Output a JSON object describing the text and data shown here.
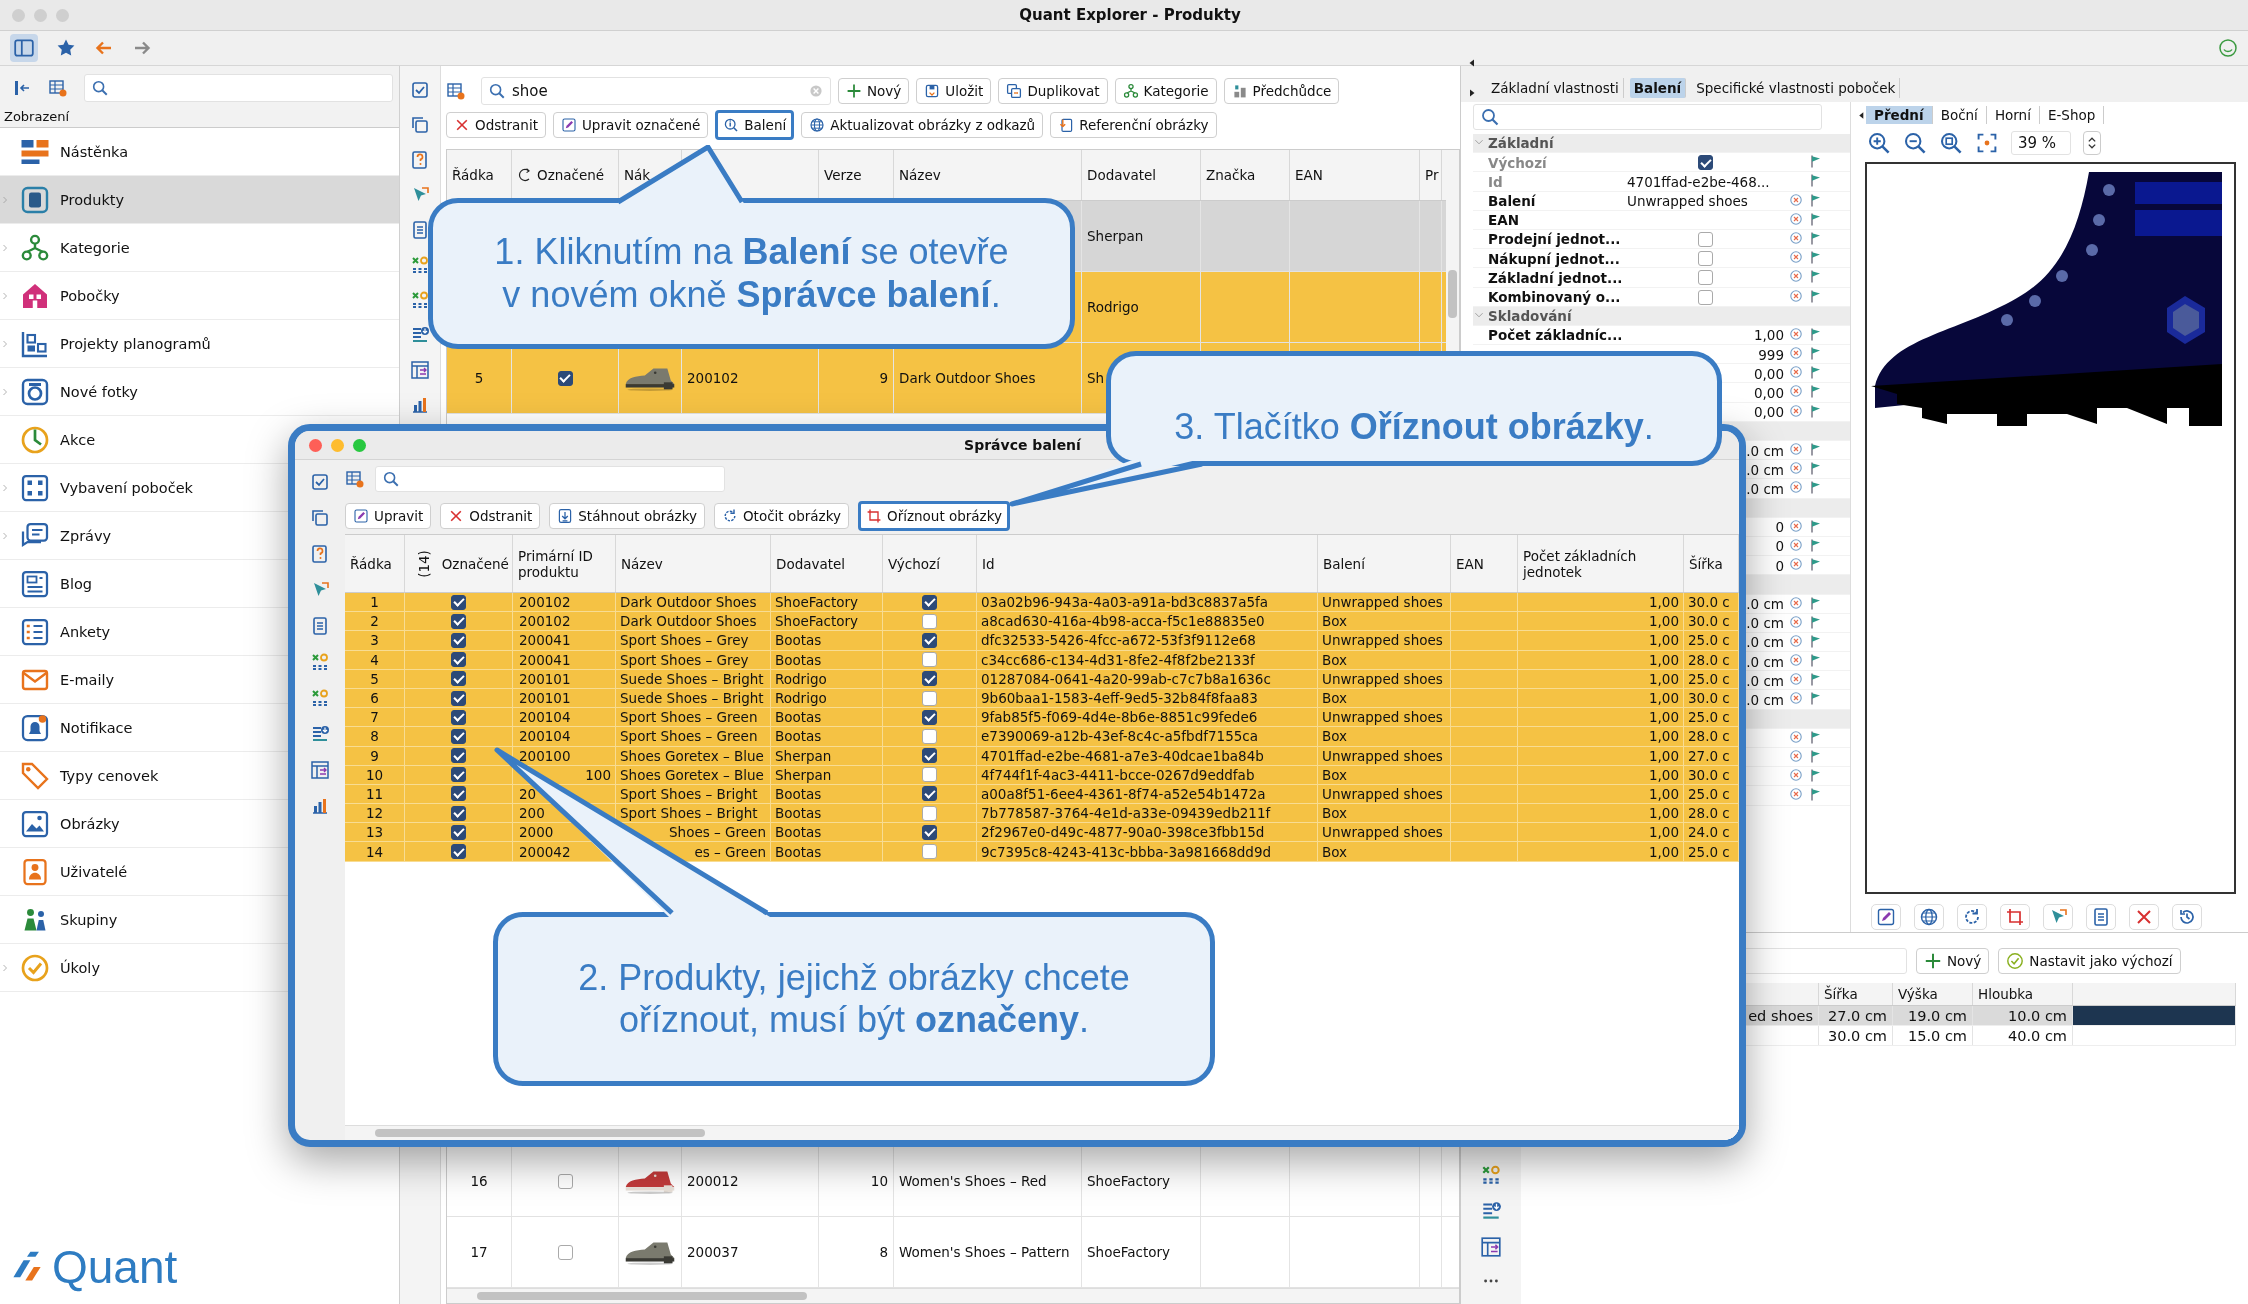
{
  "window": {
    "title": "Quant Explorer - Produkty"
  },
  "sidebar": {
    "section": "Zobrazení",
    "items": [
      {
        "label": "Nástěnka",
        "expandable": false,
        "selected": false
      },
      {
        "label": "Produkty",
        "expandable": true,
        "selected": true
      },
      {
        "label": "Kategorie",
        "expandable": true,
        "selected": false
      },
      {
        "label": "Pobočky",
        "expandable": true,
        "selected": false
      },
      {
        "label": "Projekty planogramů",
        "expandable": true,
        "selected": false
      },
      {
        "label": "Nové fotky",
        "expandable": true,
        "selected": false
      },
      {
        "label": "Akce",
        "expandable": false,
        "selected": false
      },
      {
        "label": "Vybavení poboček",
        "expandable": true,
        "selected": false
      },
      {
        "label": "Zprávy",
        "expandable": true,
        "selected": false
      },
      {
        "label": "Blog",
        "expandable": false,
        "selected": false
      },
      {
        "label": "Ankety",
        "expandable": false,
        "selected": false
      },
      {
        "label": "E-maily",
        "expandable": false,
        "selected": false
      },
      {
        "label": "Notifikace",
        "expandable": false,
        "selected": false
      },
      {
        "label": "Typy cenovek",
        "expandable": false,
        "selected": false
      },
      {
        "label": "Obrázky",
        "expandable": false,
        "selected": false
      },
      {
        "label": "Uživatelé",
        "expandable": false,
        "selected": false
      },
      {
        "label": "Skupiny",
        "expandable": false,
        "selected": false
      },
      {
        "label": "Úkoly",
        "expandable": true,
        "selected": false
      }
    ],
    "logo": "Quant"
  },
  "products": {
    "search": {
      "value": "shoe"
    },
    "toolbar": [
      "Nový",
      "Uložit",
      "Duplikovat",
      "Kategorie",
      "Předchůdce"
    ],
    "actions": [
      {
        "label": "Odstranit",
        "highlighted": false
      },
      {
        "label": "Upravit označené",
        "highlighted": false
      },
      {
        "label": "Balení",
        "highlighted": true
      },
      {
        "label": "Aktualizovat obrázky z odkazů",
        "highlighted": false
      },
      {
        "label": "Referenční obrázky",
        "highlighted": false
      }
    ],
    "columns": [
      "Řádka",
      "Označené",
      "Nák",
      null,
      "Verze",
      "Název",
      "Dodavatel",
      "Značka",
      "EAN",
      "Pr"
    ],
    "rows_top": [
      {
        "selected": true,
        "marked": false,
        "supplier": "Sherpan"
      },
      {
        "selected": false,
        "marked": true,
        "supplier": "Rodrigo"
      },
      {
        "selected": false,
        "marked": true,
        "number": "5",
        "checked": true,
        "product_id": "200102",
        "version": "9",
        "name": "Dark Outdoor Shoes",
        "supplier": "Sh"
      }
    ],
    "rows_bottom": [
      {
        "selected": false,
        "marked": false,
        "number": "16",
        "checked": false,
        "product_id": "200012",
        "version": "10",
        "name": "Women's Shoes – Red",
        "supplier": "ShoeFactory"
      },
      {
        "selected": false,
        "marked": false,
        "number": "17",
        "checked": false,
        "product_id": "200037",
        "version": "8",
        "name": "Women's Shoes – Pattern",
        "supplier": "ShoeFactory"
      }
    ]
  },
  "properties": {
    "tabs": [
      {
        "label": "Základní vlastnosti",
        "selected": false
      },
      {
        "label": "Balení",
        "selected": true
      },
      {
        "label": "Specifické vlastnosti poboček",
        "selected": false
      }
    ],
    "rows": [
      {
        "kind": "group",
        "label": "Základní",
        "expanded": true
      },
      {
        "kind": "check",
        "label": "Výchozí",
        "checked": true,
        "readonly": true,
        "resettable": false
      },
      {
        "kind": "text",
        "label": "Id",
        "value": "4701ffad-e2be-468...",
        "readonly": true,
        "resettable": false
      },
      {
        "kind": "text",
        "label": "Balení",
        "value": "Unwrapped shoes",
        "readonly": false,
        "resettable": true
      },
      {
        "kind": "text",
        "label": "EAN",
        "readonly": false,
        "resettable": true
      },
      {
        "kind": "check",
        "label": "Prodejní jednot...",
        "checked": false,
        "readonly": false,
        "resettable": true
      },
      {
        "kind": "check",
        "label": "Nákupní jednot...",
        "checked": false,
        "readonly": false,
        "resettable": true
      },
      {
        "kind": "check",
        "label": "Základní jednot...",
        "checked": false,
        "readonly": false,
        "resettable": true
      },
      {
        "kind": "check",
        "label": "Kombinovaný o...",
        "checked": false,
        "readonly": false,
        "resettable": true
      },
      {
        "kind": "group",
        "label": "Skladování",
        "expanded": true
      },
      {
        "kind": "number",
        "label": "Počet základníc...",
        "value": "1,00",
        "readonly": false,
        "resettable": true
      },
      {
        "kind": "number",
        "value": "999",
        "readonly": false,
        "resettable": true
      },
      {
        "kind": "number",
        "value": "0,00",
        "readonly": false,
        "resettable": true
      },
      {
        "kind": "number",
        "value": "0,00",
        "readonly": false,
        "resettable": true
      },
      {
        "kind": "number",
        "value": "0,00",
        "readonly": false,
        "resettable": true
      },
      {
        "kind": "group"
      },
      {
        "kind": "number",
        "value": ".0 cm",
        "readonly": false,
        "resettable": true
      },
      {
        "kind": "number",
        "value": ".0 cm",
        "readonly": false,
        "resettable": true
      },
      {
        "kind": "number",
        "value": ".0 cm",
        "readonly": false,
        "resettable": true
      },
      {
        "kind": "group"
      },
      {
        "kind": "number",
        "value": "0",
        "readonly": false,
        "resettable": true
      },
      {
        "kind": "number",
        "value": "0",
        "readonly": false,
        "resettable": true
      },
      {
        "kind": "number",
        "value": "0",
        "readonly": false,
        "resettable": true
      },
      {
        "kind": "group"
      },
      {
        "kind": "number",
        "value": ".0 cm",
        "readonly": false,
        "resettable": true
      },
      {
        "kind": "number",
        "value": ".0 cm",
        "readonly": false,
        "resettable": true
      },
      {
        "kind": "number",
        "value": ".0 cm",
        "readonly": false,
        "resettable": true
      },
      {
        "kind": "number",
        "value": ".0 cm",
        "readonly": false,
        "resettable": true
      },
      {
        "kind": "number",
        "value": ".0 cm",
        "readonly": false,
        "resettable": true
      },
      {
        "kind": "number",
        "value": ".0 cm",
        "readonly": false,
        "resettable": true
      },
      {
        "kind": "group"
      },
      {
        "kind": "number",
        "readonly": false,
        "resettable": true
      },
      {
        "kind": "number",
        "readonly": false,
        "resettable": true
      },
      {
        "kind": "number",
        "readonly": false,
        "resettable": true
      },
      {
        "kind": "number",
        "readonly": false,
        "resettable": true
      }
    ]
  },
  "preview": {
    "tabs": [
      {
        "label": "Přední",
        "selected": true
      },
      {
        "label": "Boční",
        "selected": false
      },
      {
        "label": "Horní",
        "selected": false
      },
      {
        "label": "E-Shop",
        "selected": false
      }
    ],
    "zoom": {
      "value": "39 %"
    }
  },
  "packaging": {
    "buttons": [
      "Nový",
      "Nastavit jako výchozí"
    ],
    "columns": [
      null,
      "Šířka",
      "Výška",
      "Hloubka"
    ],
    "rows": [
      {
        "selected": true,
        "cells": [
          {
            "text": "ed shoes",
            "start_hidden": true
          },
          "27.0 cm",
          "19.0 cm",
          "10.0 cm"
        ]
      },
      {
        "selected": false,
        "cells": [
          null,
          "30.0 cm",
          "15.0 cm",
          "40.0 cm"
        ]
      }
    ]
  },
  "dialog": {
    "title": "Správce balení",
    "actions": [
      {
        "label": "Upravit",
        "highlighted": false
      },
      {
        "label": "Odstranit",
        "highlighted": false
      },
      {
        "label": "Stáhnout obrázky",
        "highlighted": false
      },
      {
        "label": "Otočit obrázky",
        "highlighted": false
      },
      {
        "label": "Oříznout obrázky",
        "highlighted": true
      }
    ],
    "marked_count": "(14)",
    "columns": [
      "Řádka",
      "Označené",
      "Primární ID produktu",
      "Název",
      "Dodavatel",
      "Výchozí",
      "Id",
      "Balení",
      "EAN",
      "Počet základních jednotek",
      "Šířka"
    ],
    "rows": [
      {
        "number": "1",
        "checked": true,
        "product_id": "200102",
        "name": "Dark Outdoor Shoes",
        "supplier": "ShoeFactory",
        "default": true,
        "id": "03a02b96-943a-4a03-a91a-bd3c8837a5fa",
        "packaging": "Unwrapped shoes",
        "units": "1,00",
        "width": "30.0 c"
      },
      {
        "number": "2",
        "checked": true,
        "product_id": "200102",
        "name": "Dark Outdoor Shoes",
        "supplier": "ShoeFactory",
        "default": false,
        "id": "a8cad630-416a-4b98-acca-f5c1e88835e0",
        "packaging": "Box",
        "units": "1,00",
        "width": "30.0 c"
      },
      {
        "number": "3",
        "checked": true,
        "product_id": "200041",
        "name": "Sport Shoes – Grey",
        "supplier": "Bootas",
        "default": true,
        "id": "dfc32533-5426-4fcc-a672-53f3f9112e68",
        "packaging": "Unwrapped shoes",
        "units": "1,00",
        "width": "25.0 c"
      },
      {
        "number": "4",
        "checked": true,
        "product_id": "200041",
        "name": "Sport Shoes – Grey",
        "supplier": "Bootas",
        "default": false,
        "id": "c34cc686-c134-4d31-8fe2-4f8f2be2133f",
        "packaging": "Box",
        "units": "1,00",
        "width": "28.0 c"
      },
      {
        "number": "5",
        "checked": true,
        "product_id": "200101",
        "name": "Suede Shoes – Bright",
        "supplier": "Rodrigo",
        "default": true,
        "id": "01287084-0641-4a20-99ab-c7c7b8a1636c",
        "packaging": "Unwrapped shoes",
        "units": "1,00",
        "width": "25.0 c"
      },
      {
        "number": "6",
        "checked": true,
        "product_id": "200101",
        "name": "Suede Shoes – Bright",
        "supplier": "Rodrigo",
        "default": false,
        "id": "9b60baa1-1583-4eff-9ed5-32b84f8faa83",
        "packaging": "Box",
        "units": "1,00",
        "width": "30.0 c"
      },
      {
        "number": "7",
        "checked": true,
        "product_id": "200104",
        "name": "Sport Shoes – Green",
        "supplier": "Bootas",
        "default": true,
        "id": "9fab85f5-f069-4d4e-8b6e-8851c99fede6",
        "packaging": "Unwrapped shoes",
        "units": "1,00",
        "width": "25.0 c"
      },
      {
        "number": "8",
        "checked": true,
        "product_id": "200104",
        "name": "Sport Shoes – Green",
        "supplier": "Bootas",
        "default": false,
        "id": "e7390069-a12b-43ef-8c4c-a5fbdf7155ca",
        "packaging": "Box",
        "units": "1,00",
        "width": "28.0 c"
      },
      {
        "number": "9",
        "checked": true,
        "product_id": "200100",
        "name": "Shoes Goretex – Blue",
        "supplier": "Sherpan",
        "default": true,
        "id": "4701ffad-e2be-4681-a7e3-40dcae1ba84b",
        "packaging": "Unwrapped shoes",
        "units": "1,00",
        "width": "27.0 c"
      },
      {
        "number": "10",
        "checked": true,
        "product_id": {
          "text": "100",
          "start_hidden": true
        },
        "name": "Shoes Goretex – Blue",
        "supplier": "Sherpan",
        "default": false,
        "id": "4f744f1f-4ac3-4411-bcce-0267d9eddfab",
        "packaging": "Box",
        "units": "1,00",
        "width": "30.0 c"
      },
      {
        "number": "11",
        "checked": true,
        "product_id": "20",
        "name": "Sport Shoes – Bright",
        "supplier": "Bootas",
        "default": true,
        "id": "a00a8f51-6ee4-4361-8f74-a52e54b1472a",
        "packaging": "Unwrapped shoes",
        "units": "1,00",
        "width": "25.0 c"
      },
      {
        "number": "12",
        "checked": true,
        "product_id": "200",
        "name": "Sport Shoes – Bright",
        "supplier": "Bootas",
        "default": false,
        "id": "7b778587-3764-4e1d-a33e-09439edb211f",
        "packaging": "Box",
        "units": "1,00",
        "width": "28.0 c"
      },
      {
        "number": "13",
        "checked": true,
        "product_id": "2000",
        "name": {
          "text": "Shoes – Green",
          "start_hidden": true
        },
        "supplier": "Bootas",
        "default": true,
        "id": "2f2967e0-d49c-4877-90a0-398ce3fbb15d",
        "packaging": "Unwrapped shoes",
        "units": "1,00",
        "width": "24.0 c"
      },
      {
        "number": "14",
        "checked": true,
        "product_id": "200042",
        "name": {
          "text": "es – Green",
          "start_hidden": true
        },
        "supplier": "Bootas",
        "default": false,
        "id": "9c7395c8-4243-413c-bbba-3a981668dd9d",
        "packaging": "Box",
        "units": "1,00",
        "width": "25.0 c"
      }
    ]
  },
  "callouts": [
    {
      "text": "1. Kliknutím na **Balení** se otevře v novém okně **Správce balení**."
    },
    {
      "text": "3. Tlačítko **Oříznout obrázky**."
    },
    {
      "text": "2. Produkty, jejichž obrázky chcete oříznout, musí být **označeny**."
    }
  ]
}
